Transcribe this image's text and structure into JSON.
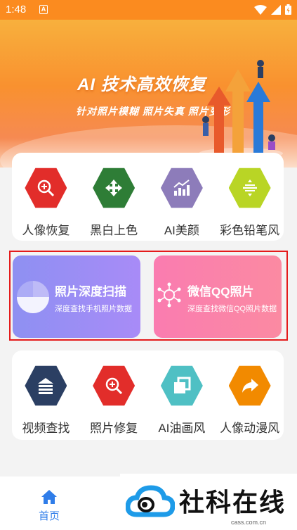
{
  "status_bar": {
    "time": "1:48",
    "badge": "A"
  },
  "banner": {
    "title": "AI 技术高效恢复",
    "subtitle": "针对照片模糊  照片失真  照片变形"
  },
  "top_tools": [
    {
      "label": "人像恢复",
      "icon": "zoom-plus-icon",
      "color": "#e22d2a"
    },
    {
      "label": "黑白上色",
      "icon": "move-arrows-icon",
      "color": "#2e7d36"
    },
    {
      "label": "AI美颜",
      "icon": "chart-trend-icon",
      "color": "#8d7cba"
    },
    {
      "label": "彩色铅笔风",
      "icon": "align-lines-icon",
      "color": "#b9d525"
    }
  ],
  "features": {
    "scan": {
      "title": "照片深度扫描",
      "desc": "深度查找手机照片数据",
      "icon": "radar-icon"
    },
    "wechat": {
      "title": "微信QQ照片",
      "desc": "深度查找微信QQ照片数据",
      "icon": "network-icon"
    }
  },
  "bottom_tools": [
    {
      "label": "视频查找",
      "icon": "stack-layers-icon",
      "color": "#2b3f63"
    },
    {
      "label": "照片修复",
      "icon": "zoom-plus-icon",
      "color": "#e22d2a"
    },
    {
      "label": "AI油画风",
      "icon": "frame-corner-icon",
      "color": "#4fc0c4"
    },
    {
      "label": "人像动漫风",
      "icon": "share-arrow-icon",
      "color": "#f28a00"
    }
  ],
  "tabbar": {
    "home_label": "首页",
    "accent": "#2f7de9"
  },
  "watermark": {
    "text": "社科在线",
    "url": "cass.com.cn"
  }
}
